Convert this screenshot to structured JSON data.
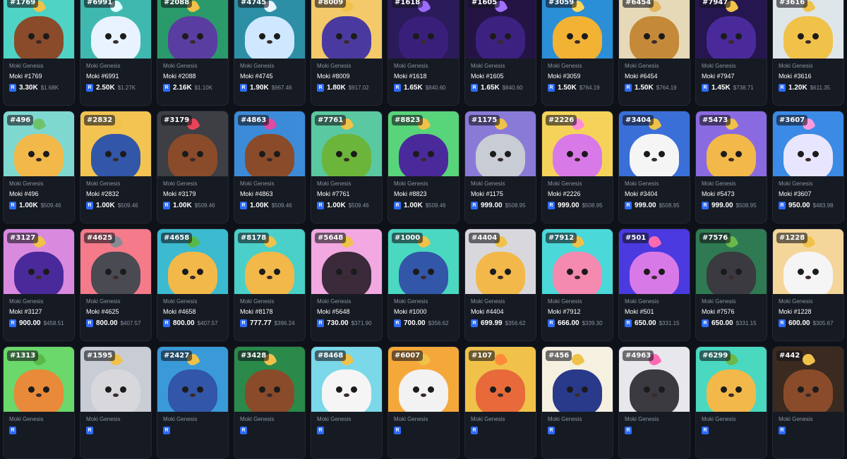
{
  "collection": "Moki Genesis",
  "currency_symbol": "R",
  "rows": [
    [
      {
        "id": "#1769",
        "name": "Moki #1769",
        "price": "3.30K",
        "usd": "$1.68K",
        "bg": "#4ed3c4",
        "body": "#8a4b2a",
        "tuft": "#f0c24a"
      },
      {
        "id": "#6991",
        "name": "Moki #6991",
        "price": "2.50K",
        "usd": "$1.27K",
        "bg": "#3fb8b0",
        "body": "#e8f3ff",
        "tuft": "#dff"
      },
      {
        "id": "#2088",
        "name": "Moki #2088",
        "price": "2.16K",
        "usd": "$1.10K",
        "bg": "#2a9a6a",
        "body": "#5a3da0",
        "tuft": "#f0c24a"
      },
      {
        "id": "#4745",
        "name": "Moki #4745",
        "price": "1.90K",
        "usd": "$967.46",
        "bg": "#2c8fa6",
        "body": "#cfe8ff",
        "tuft": "#eaf6ff"
      },
      {
        "id": "#8009",
        "name": "Moki #8009",
        "price": "1.80K",
        "usd": "$917.02",
        "bg": "#f3c96a",
        "body": "#4a3aa0",
        "tuft": "#f0c24a"
      },
      {
        "id": "#1618",
        "name": "Moki #1618",
        "price": "1.65K",
        "usd": "$840.60",
        "bg": "#2b1b5a",
        "body": "#3a1f7a",
        "tuft": "#9b6bff"
      },
      {
        "id": "#1605",
        "name": "Moki #1605",
        "price": "1.65K",
        "usd": "$840.60",
        "bg": "#241444",
        "body": "#3d2180",
        "tuft": "#a070ff"
      },
      {
        "id": "#3059",
        "name": "Moki #3059",
        "price": "1.50K",
        "usd": "$764.19",
        "bg": "#2a8fd6",
        "body": "#f2b233",
        "tuft": "#ffd65a"
      },
      {
        "id": "#6454",
        "name": "Moki #6454",
        "price": "1.50K",
        "usd": "$764.19",
        "bg": "#e6d9b8",
        "body": "#c48a3a",
        "tuft": "#e3b45a"
      },
      {
        "id": "#7947",
        "name": "Moki #7947",
        "price": "1.45K",
        "usd": "$738.71",
        "bg": "#25164f",
        "body": "#4a2a9a",
        "tuft": "#f0c24a"
      },
      {
        "id": "#3616",
        "name": "Moki #3616",
        "price": "1.20K",
        "usd": "$611.35",
        "bg": "#dfe6ea",
        "body": "#f0c24a",
        "tuft": "#f0c24a"
      }
    ],
    [
      {
        "id": "#496",
        "name": "Moki #496",
        "price": "1.00K",
        "usd": "$509.46",
        "bg": "#7fd8d0",
        "body": "#f2b84a",
        "tuft": "#6ec36a"
      },
      {
        "id": "#2832",
        "name": "Moki #2832",
        "price": "1.00K",
        "usd": "$509.46",
        "bg": "#f3c452",
        "body": "#3256a8",
        "tuft": "#f0c24a"
      },
      {
        "id": "#3179",
        "name": "Moki #3179",
        "price": "1.00K",
        "usd": "$509.46",
        "bg": "#3d3f45",
        "body": "#8a4b2a",
        "tuft": "#e8455a"
      },
      {
        "id": "#4863",
        "name": "Moki #4863",
        "price": "1.00K",
        "usd": "$509.46",
        "bg": "#3c8bd8",
        "body": "#8a4b2a",
        "tuft": "#e04aa0"
      },
      {
        "id": "#7761",
        "name": "Moki #7761",
        "price": "1.00K",
        "usd": "$509.46",
        "bg": "#5ac8a0",
        "body": "#6bb63a",
        "tuft": "#f0c24a"
      },
      {
        "id": "#8823",
        "name": "Moki #8823",
        "price": "1.00K",
        "usd": "$509.46",
        "bg": "#58d47a",
        "body": "#4a2a9a",
        "tuft": "#f0c24a"
      },
      {
        "id": "#1175",
        "name": "Moki #1175",
        "price": "999.00",
        "usd": "$508.95",
        "bg": "#8a7ad8",
        "body": "#c8ccd4",
        "tuft": "#f0c24a"
      },
      {
        "id": "#2226",
        "name": "Moki #2226",
        "price": "999.00",
        "usd": "$508.95",
        "bg": "#f5d35a",
        "body": "#d879e8",
        "tuft": "#ff8ad8"
      },
      {
        "id": "#3404",
        "name": "Moki #3404",
        "price": "999.00",
        "usd": "$508.95",
        "bg": "#3a6fd8",
        "body": "#f5f5f5",
        "tuft": "#f0c24a"
      },
      {
        "id": "#5473",
        "name": "Moki #5473",
        "price": "999.00",
        "usd": "$508.95",
        "bg": "#8a6ae0",
        "body": "#f2b84a",
        "tuft": "#f0c24a"
      },
      {
        "id": "#3607",
        "name": "Moki #3607",
        "price": "950.00",
        "usd": "$483.98",
        "bg": "#3b8ae6",
        "body": "#e8e6ff",
        "tuft": "#ff9ae0"
      }
    ],
    [
      {
        "id": "#3127",
        "name": "Moki #3127",
        "price": "900.00",
        "usd": "$458.51",
        "bg": "#d98adf",
        "body": "#4a2a9a",
        "tuft": "#f0c24a"
      },
      {
        "id": "#4625",
        "name": "Moki #4625",
        "price": "800.00",
        "usd": "$407.57",
        "bg": "#f57a8a",
        "body": "#4a4a52",
        "tuft": "#8a8a94"
      },
      {
        "id": "#4658",
        "name": "Moki #4658",
        "price": "800.00",
        "usd": "$407.57",
        "bg": "#3bbad0",
        "body": "#f2b84a",
        "tuft": "#5ab84a"
      },
      {
        "id": "#8178",
        "name": "Moki #8178",
        "price": "777.77",
        "usd": "$396.24",
        "bg": "#4ad0c8",
        "body": "#f2b84a",
        "tuft": "#f0c24a"
      },
      {
        "id": "#5648",
        "name": "Moki #5648",
        "price": "730.00",
        "usd": "$371.90",
        "bg": "#f2a8e0",
        "body": "#3a2a3a",
        "tuft": "#f0c24a"
      },
      {
        "id": "#1000",
        "name": "Moki #1000",
        "price": "700.00",
        "usd": "$356.62",
        "bg": "#4ad8c0",
        "body": "#3256a8",
        "tuft": "#f0c24a"
      },
      {
        "id": "#4404",
        "name": "Moki #4404",
        "price": "699.99",
        "usd": "$356.62",
        "bg": "#d8d8dc",
        "body": "#f2b84a",
        "tuft": "#f0c24a"
      },
      {
        "id": "#7912",
        "name": "Moki #7912",
        "price": "666.00",
        "usd": "$339.30",
        "bg": "#4ad8d8",
        "body": "#f58ab0",
        "tuft": "#f0c24a"
      },
      {
        "id": "#501",
        "name": "Moki #501",
        "price": "650.00",
        "usd": "$331.15",
        "bg": "#4a3ae0",
        "body": "#d879e8",
        "tuft": "#ff6ab0"
      },
      {
        "id": "#7576",
        "name": "Moki #7576",
        "price": "650.00",
        "usd": "$331.15",
        "bg": "#2f7a52",
        "body": "#3a3a40",
        "tuft": "#6ab84a"
      },
      {
        "id": "#1228",
        "name": "Moki #1228",
        "price": "600.00",
        "usd": "$305.67",
        "bg": "#f5d69a",
        "body": "#f5f5f5",
        "tuft": "#f0c24a"
      }
    ],
    [
      {
        "id": "#1313",
        "name": "",
        "price": "",
        "usd": "",
        "bg": "#6ad86a",
        "body": "#e88a3a",
        "tuft": "#5ab84a"
      },
      {
        "id": "#1595",
        "name": "",
        "price": "",
        "usd": "",
        "bg": "#c8ccd4",
        "body": "#d8d8dc",
        "tuft": "#f0c24a"
      },
      {
        "id": "#2427",
        "name": "",
        "price": "",
        "usd": "",
        "bg": "#3a9ad8",
        "body": "#3256a8",
        "tuft": "#f0c24a"
      },
      {
        "id": "#3428",
        "name": "",
        "price": "",
        "usd": "",
        "bg": "#2a8a4a",
        "body": "#8a4b2a",
        "tuft": "#f0c24a"
      },
      {
        "id": "#8468",
        "name": "",
        "price": "",
        "usd": "",
        "bg": "#7ad8e8",
        "body": "#f5f5f5",
        "tuft": "#f0c24a"
      },
      {
        "id": "#6007",
        "name": "",
        "price": "",
        "usd": "",
        "bg": "#f5a83a",
        "body": "#f2f2f2",
        "tuft": "#f0c24a"
      },
      {
        "id": "#107",
        "name": "",
        "price": "",
        "usd": "",
        "bg": "#f0c24a",
        "body": "#e86a3a",
        "tuft": "#ff8a3a"
      },
      {
        "id": "#456",
        "name": "",
        "price": "",
        "usd": "",
        "bg": "#f5f0e0",
        "body": "#2a3a8a",
        "tuft": "#f0c24a"
      },
      {
        "id": "#4963",
        "name": "",
        "price": "",
        "usd": "",
        "bg": "#e8e8ec",
        "body": "#3a3a40",
        "tuft": "#ff6ab0"
      },
      {
        "id": "#6299",
        "name": "",
        "price": "",
        "usd": "",
        "bg": "#4ad8c0",
        "body": "#f2b84a",
        "tuft": "#6ab84a"
      },
      {
        "id": "#442",
        "name": "",
        "price": "",
        "usd": "",
        "bg": "#3a2a20",
        "body": "#8a4b2a",
        "tuft": "#f0c24a"
      }
    ]
  ]
}
